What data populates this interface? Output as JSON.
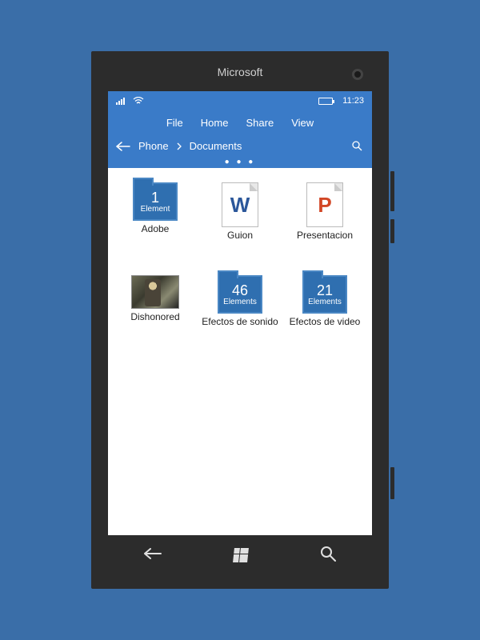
{
  "phone": {
    "brand": "Microsoft"
  },
  "status": {
    "time": "11:23"
  },
  "menu": {
    "file": "File",
    "home": "Home",
    "share": "Share",
    "view": "View"
  },
  "breadcrumb": {
    "root": "Phone",
    "current": "Documents"
  },
  "items": [
    {
      "type": "folder",
      "count": "1",
      "count_label": "Element",
      "label": "Adobe"
    },
    {
      "type": "doc",
      "letter": "W",
      "letter_color": "#2b579a",
      "label": "Guion"
    },
    {
      "type": "doc",
      "letter": "P",
      "letter_color": "#d24726",
      "label": "Presentacion"
    },
    {
      "type": "thumb",
      "label": "Dishonored"
    },
    {
      "type": "folder",
      "count": "46",
      "count_label": "Elements",
      "label": "Efectos de sonido"
    },
    {
      "type": "folder",
      "count": "21",
      "count_label": "Elements",
      "label": "Efectos de video"
    }
  ]
}
